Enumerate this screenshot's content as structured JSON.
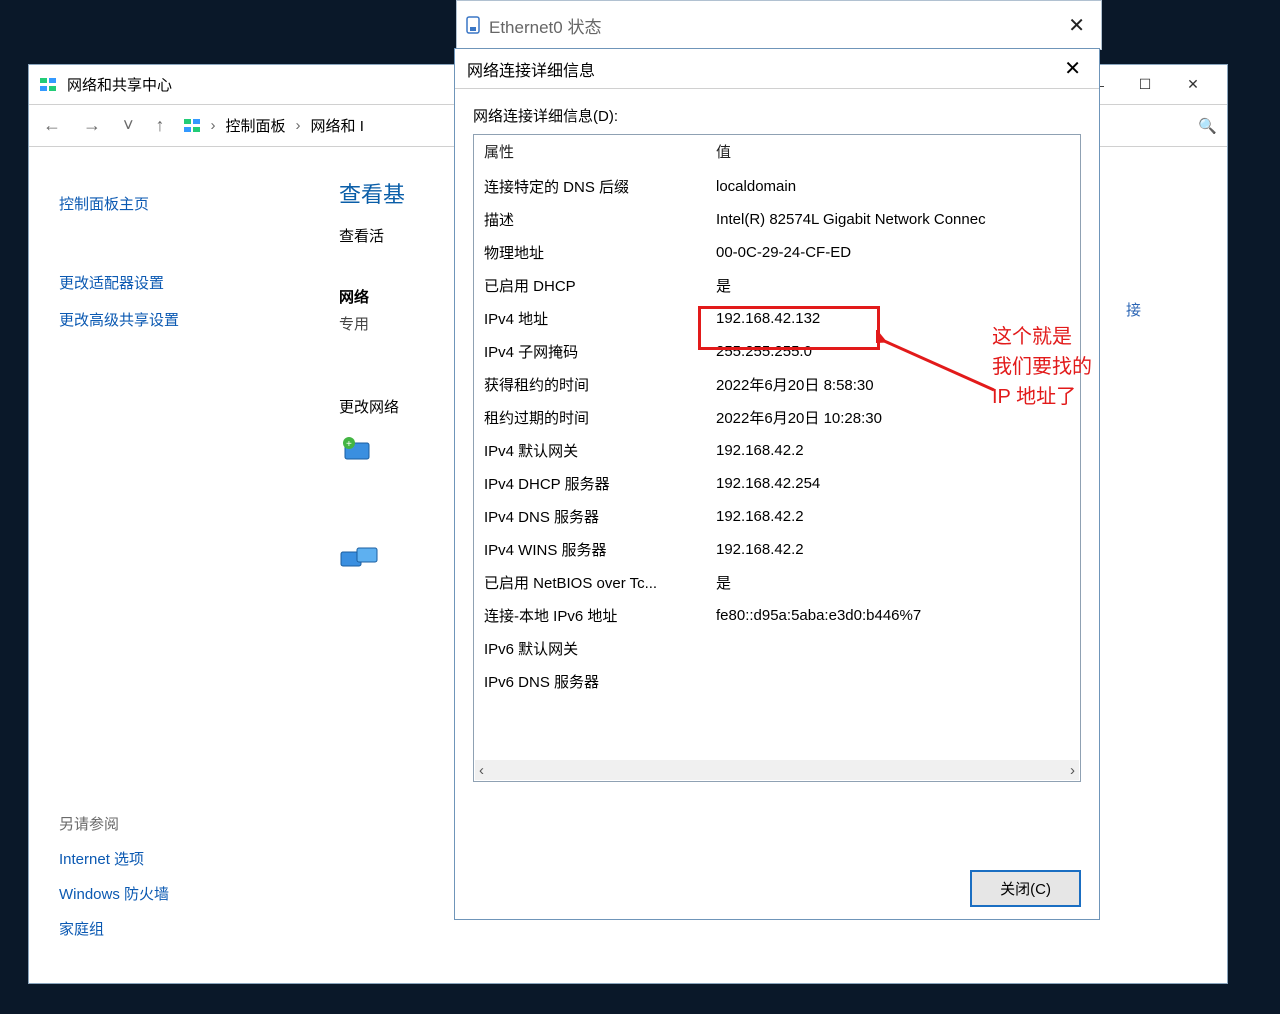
{
  "cp": {
    "title": "网络和共享中心",
    "nav_back": "←",
    "nav_fwd": "→",
    "nav_drop": "˅",
    "nav_up": "↑",
    "path_root": "控制面板",
    "path_seg": "网络和 I",
    "path_sep": "›",
    "search_icon": "🔍",
    "side_home": "控制面板主页",
    "side_adapter": "更改适配器设置",
    "side_adv": "更改高级共享设置",
    "main_hd": "查看基",
    "main_sub": "查看活",
    "net_label": "网络",
    "net_sub": "专用",
    "change_hdr": "更改网络",
    "see_also_hdr": "另请参阅",
    "see_also_inet": "Internet 选项",
    "see_also_fw": "Windows 防火墙",
    "see_also_hg": "家庭组",
    "note_char": "接",
    "min": "—",
    "restore": "☐",
    "close": "✕"
  },
  "eth": {
    "title": "Ethernet0 状态",
    "close": "✕"
  },
  "dlg": {
    "title": "网络连接详细信息",
    "close": "✕",
    "label": "网络连接详细信息(D):",
    "col_prop": "属性",
    "col_val": "值",
    "btn_close": "关闭(C)",
    "scroll_left": "‹",
    "scroll_right": "›"
  },
  "props": [
    {
      "k": "连接特定的 DNS 后缀",
      "v": "localdomain"
    },
    {
      "k": "描述",
      "v": "Intel(R) 82574L Gigabit Network Connec"
    },
    {
      "k": "物理地址",
      "v": "00-0C-29-24-CF-ED"
    },
    {
      "k": "已启用 DHCP",
      "v": "是"
    },
    {
      "k": "IPv4 地址",
      "v": "192.168.42.132"
    },
    {
      "k": "IPv4 子网掩码",
      "v": "255.255.255.0"
    },
    {
      "k": "获得租约的时间",
      "v": "2022年6月20日 8:58:30"
    },
    {
      "k": "租约过期的时间",
      "v": "2022年6月20日 10:28:30"
    },
    {
      "k": "IPv4 默认网关",
      "v": "192.168.42.2"
    },
    {
      "k": "IPv4 DHCP 服务器",
      "v": "192.168.42.254"
    },
    {
      "k": "IPv4 DNS 服务器",
      "v": "192.168.42.2"
    },
    {
      "k": "IPv4 WINS 服务器",
      "v": "192.168.42.2"
    },
    {
      "k": "已启用 NetBIOS over Tc...",
      "v": "是"
    },
    {
      "k": "连接-本地 IPv6 地址",
      "v": "fe80::d95a:5aba:e3d0:b446%7"
    },
    {
      "k": "IPv6 默认网关",
      "v": ""
    },
    {
      "k": "IPv6 DNS 服务器",
      "v": ""
    }
  ],
  "anno": {
    "l1": "这个就是",
    "l2": "我们要找的",
    "l3": "IP 地址了"
  }
}
